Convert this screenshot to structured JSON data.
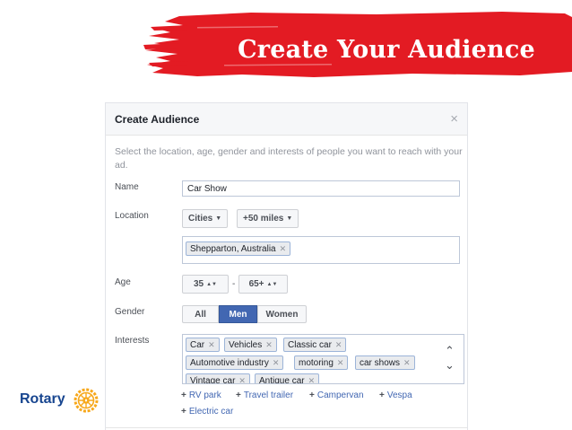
{
  "banner": {
    "title": "Create Your Audience",
    "color": "#e31b23"
  },
  "dialog": {
    "title": "Create Audience",
    "close_glyph": "×",
    "intro": "Select the location, age, gender and interests of people you want to reach with your ad.",
    "name": {
      "label": "Name",
      "value": "Car Show"
    },
    "location": {
      "label": "Location",
      "type_select": "Cities",
      "radius_select": "+50 miles",
      "tokens": [
        "Shepparton, Australia"
      ]
    },
    "age": {
      "label": "Age",
      "min": "35",
      "separator": "-",
      "max": "65+"
    },
    "gender": {
      "label": "Gender",
      "options": [
        "All",
        "Men",
        "Women"
      ],
      "selected": "Men"
    },
    "interests": {
      "label": "Interests",
      "tokens": [
        "Car",
        "Vehicles",
        "Classic car",
        "Automotive industry",
        "motoring",
        "car shows",
        "Vintage car",
        "Antique car"
      ],
      "suggestions": [
        "RV park",
        "Travel trailer",
        "Campervan",
        "Vespa",
        "Electric car"
      ]
    }
  },
  "logo": {
    "text": "Rotary",
    "color": "#17458f",
    "wheel_color": "#f7a81b",
    "icon": "rotary-wheel-icon"
  },
  "accent": "#4267b2"
}
